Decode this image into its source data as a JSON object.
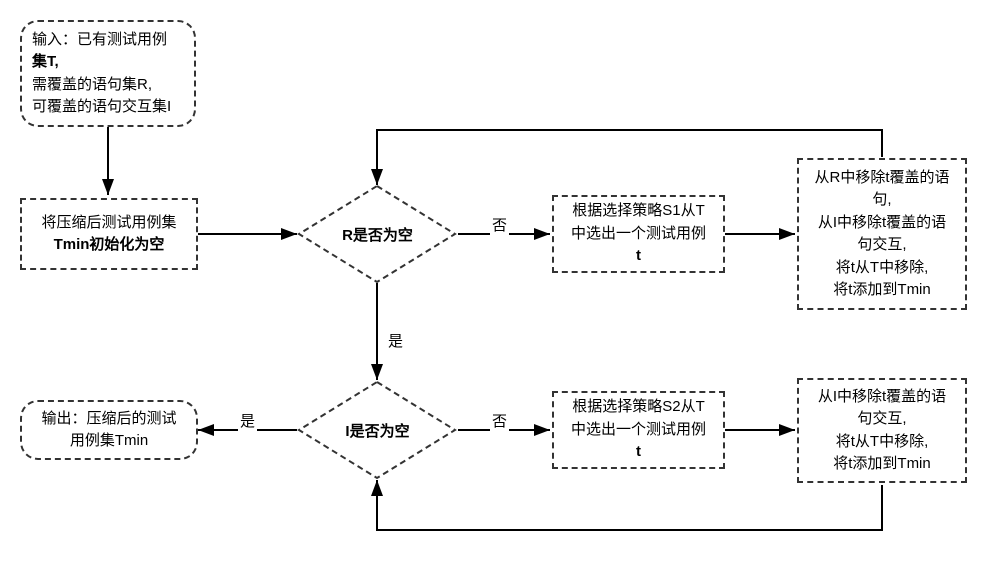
{
  "nodes": {
    "input": {
      "l1": "输入：已有测试用例",
      "l2_b": "集T,",
      "l3": "需覆盖的语句集R,",
      "l4": "可覆盖的语句交互集I"
    },
    "init": {
      "l1": "将压缩后测试用例集",
      "l2_b": "Tmin初始化为空"
    },
    "d1": {
      "label": "R是否为空"
    },
    "s1": {
      "l1": "根据选择策略S1从T",
      "l2": "中选出一个测试用例",
      "l3_b": "t"
    },
    "update1": {
      "l1": "从R中移除t覆盖的语",
      "l2": "句,",
      "l3": "从I中移除t覆盖的语",
      "l4": "句交互,",
      "l5": "将t从T中移除,",
      "l6": "将t添加到Tmin"
    },
    "d2": {
      "label": "I是否为空"
    },
    "s2": {
      "l1": "根据选择策略S2从T",
      "l2": "中选出一个测试用例",
      "l3_b": "t"
    },
    "update2": {
      "l1": "从I中移除t覆盖的语",
      "l2": "句交互,",
      "l3": "将t从T中移除,",
      "l4": "将t添加到Tmin"
    },
    "output": {
      "l1": "输出：压缩后的测试",
      "l2": "用例集Tmin"
    }
  },
  "edges": {
    "yes": "是",
    "no": "否"
  }
}
